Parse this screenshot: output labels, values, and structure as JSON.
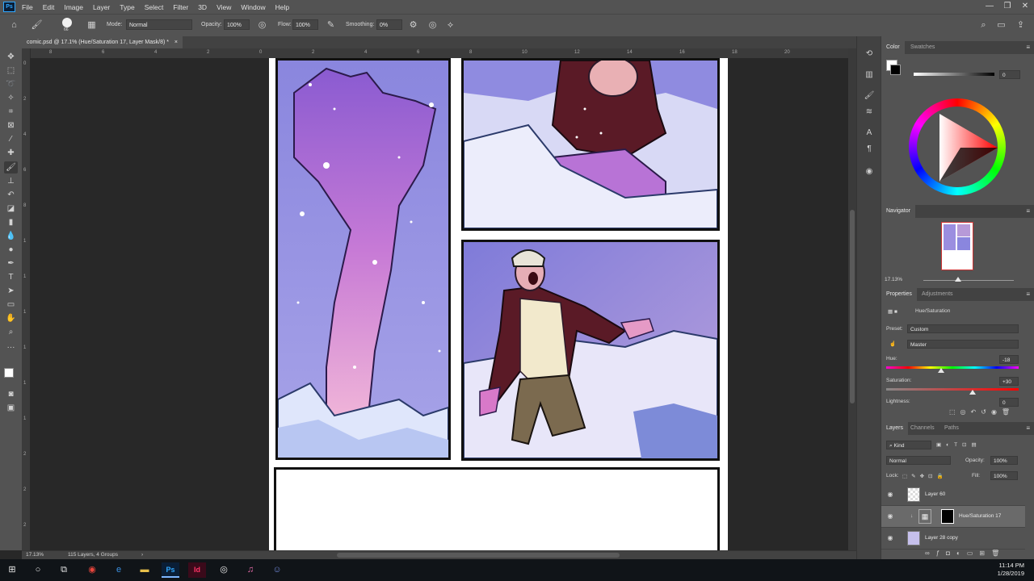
{
  "menubar": {
    "logo": "Ps",
    "items": [
      "File",
      "Edit",
      "Image",
      "Layer",
      "Type",
      "Select",
      "Filter",
      "3D",
      "View",
      "Window",
      "Help"
    ],
    "window_controls": [
      "—",
      "❐",
      "✕"
    ]
  },
  "options": {
    "brush_size": "66",
    "mode_label": "Mode:",
    "mode_value": "Normal",
    "opacity_label": "Opacity:",
    "opacity_value": "100%",
    "flow_label": "Flow:",
    "flow_value": "100%",
    "smoothing_label": "Smoothing:",
    "smoothing_value": "0%"
  },
  "document": {
    "tab_title": "comic.psd @ 17.1% (Hue/Saturation 17, Layer Mask/8) *",
    "close": "×"
  },
  "ruler": {
    "top_ticks": [
      "8",
      "6",
      "4",
      "2",
      "0",
      "2",
      "4",
      "6",
      "8",
      "10",
      "12",
      "14",
      "16",
      "18",
      "20"
    ],
    "left_ticks": [
      "0",
      "2",
      "4",
      "6",
      "8",
      "1",
      "1",
      "1",
      "1",
      "1",
      "1",
      "2",
      "2",
      "2"
    ]
  },
  "status": {
    "zoom": "17.13%",
    "info": "115 Layers, 4 Groups",
    "arrow": "›"
  },
  "color_panel": {
    "tabs": [
      "Color",
      "Swatches"
    ],
    "value": "0",
    "foreground": "#ffffff",
    "background": "#000000"
  },
  "navigator": {
    "title": "Navigator",
    "zoom": "17.13%"
  },
  "properties": {
    "tabs": [
      "Properties",
      "Adjustments"
    ],
    "adjustment_name": "Hue/Saturation",
    "preset_label": "Preset:",
    "preset_value": "Custom",
    "channel_value": "Master",
    "hue_label": "Hue:",
    "hue_value": "-18",
    "saturation_label": "Saturation:",
    "saturation_value": "+30",
    "lightness_label": "Lightness:",
    "lightness_value": "0"
  },
  "layers_panel": {
    "tabs": [
      "Layers",
      "Channels",
      "Paths"
    ],
    "filter_kind": "Kind",
    "blend_mode": "Normal",
    "opacity_label": "Opacity:",
    "opacity_value": "100%",
    "lock_label": "Lock:",
    "fill_label": "Fill:",
    "fill_value": "100%",
    "layers": [
      {
        "name": "Layer 60"
      },
      {
        "name": "Hue/Saturation 17"
      },
      {
        "name": "Layer 28 copy"
      }
    ]
  },
  "taskbar": {
    "time": "11:14 PM",
    "date": "1/28/2019",
    "apps": [
      "start",
      "cortana",
      "task-view",
      "chrome",
      "edge",
      "file-explorer",
      "photoshop",
      "indesign",
      "obs",
      "itunes",
      "discord"
    ]
  },
  "colors": {
    "ui_panel": "#535353",
    "canvas_bg": "#282828",
    "accent": "#31a8ff",
    "indesign": "#ff3366"
  }
}
